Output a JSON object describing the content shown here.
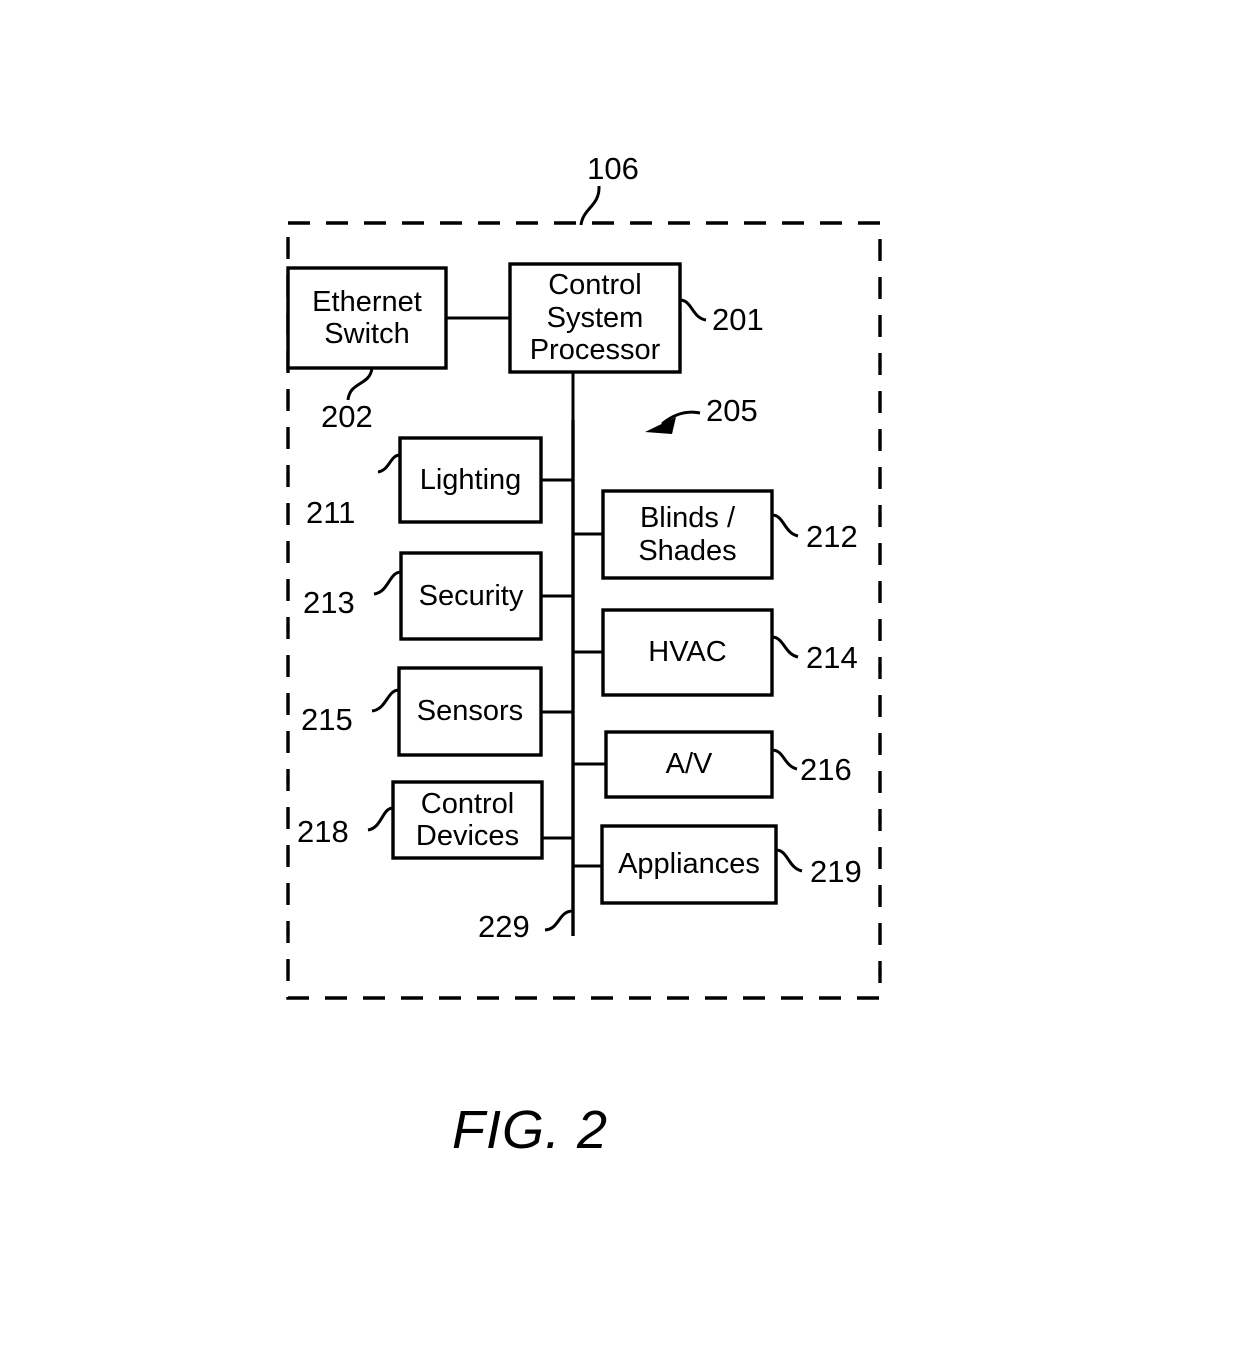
{
  "figure": {
    "caption": "FIG. 2",
    "enclosure_ref": "106",
    "bus_ref": "229",
    "bus_arrow_ref": "205"
  },
  "nodes": {
    "ethernet_switch": {
      "label": "Ethernet\nSwitch",
      "ref": "202"
    },
    "control_system_processor": {
      "label": "Control\nSystem\nProcessor",
      "ref": "201"
    },
    "lighting": {
      "label": "Lighting",
      "ref": "211"
    },
    "security": {
      "label": "Security",
      "ref": "213"
    },
    "sensors": {
      "label": "Sensors",
      "ref": "215"
    },
    "control_devices": {
      "label": "Control\nDevices",
      "ref": "218"
    },
    "blinds_shades": {
      "label": "Blinds /\nShades",
      "ref": "212"
    },
    "hvac": {
      "label": "HVAC",
      "ref": "214"
    },
    "av": {
      "label": "A/V",
      "ref": "216"
    },
    "appliances": {
      "label": "Appliances",
      "ref": "219"
    }
  },
  "colors": {
    "stroke": "#000000",
    "background": "#ffffff"
  }
}
